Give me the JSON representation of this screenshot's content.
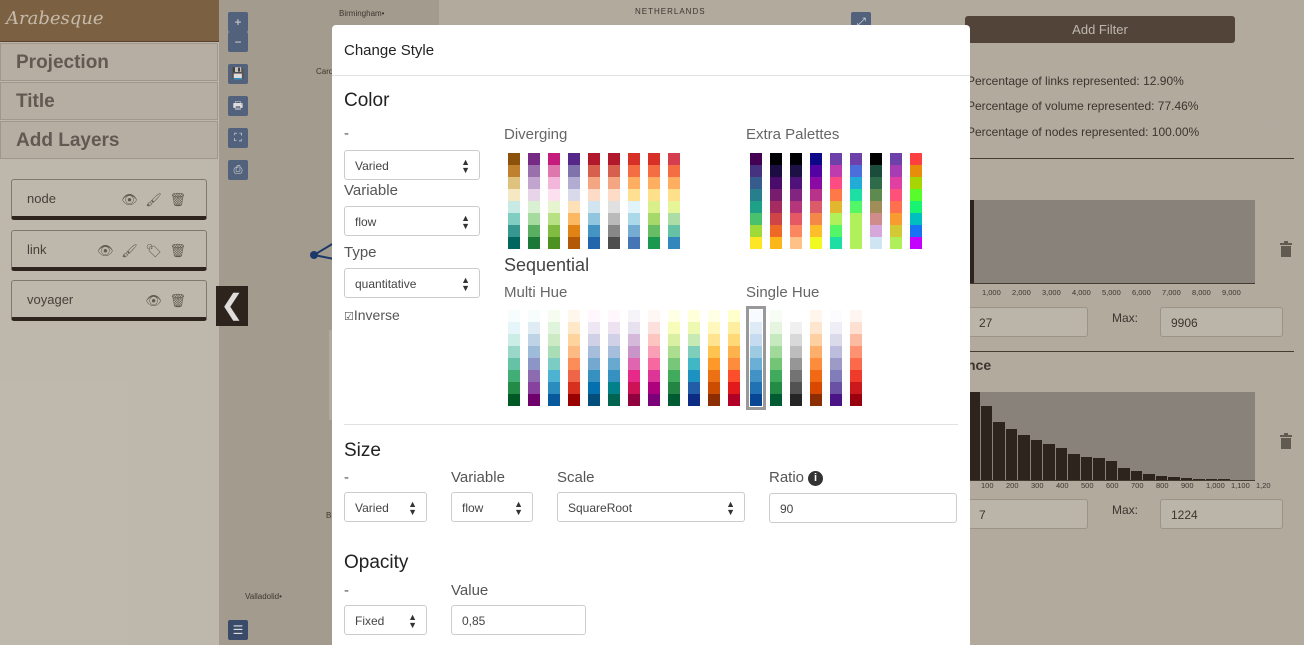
{
  "app": {
    "logo": "Arabesque"
  },
  "sidebar": {
    "menu": [
      "Projection",
      "Title",
      "Add Layers"
    ],
    "layers": [
      {
        "name": "node",
        "icons": "👁 🖌 🗑"
      },
      {
        "name": "link",
        "icons": "👁 🖌 🏷 🗑"
      },
      {
        "name": "voyager",
        "icons": "👁 🗑"
      }
    ],
    "collapse_glyph": "❮"
  },
  "map": {
    "labels": [
      "Birmingham•",
      "NETHERLANDS",
      "Valladolid•",
      "Card",
      "B"
    ],
    "buttons": [
      "+",
      "−",
      "💾",
      "🖶",
      "⛶",
      "⎙"
    ]
  },
  "right_panel": {
    "add_filter": "Add Filter",
    "stats": [
      "Percentage of links represented: 12.90%",
      "Percentage of volume represented: 77.46%",
      "Percentage of nodes represented: 100.00%"
    ],
    "hist1": {
      "axis": [
        "1,000",
        "2,000",
        "3,000",
        "4,000",
        "5,000",
        "6,000",
        "7,000",
        "8,000",
        "9,000"
      ],
      "min": "27",
      "max_label": "Max:",
      "max": "9906"
    },
    "hist2": {
      "title": "nce",
      "axis": [
        "100",
        "200",
        "300",
        "400",
        "500",
        "600",
        "700",
        "800",
        "900",
        "1,000",
        "1,100",
        "1,20"
      ],
      "min": "7",
      "max_label": "Max:",
      "max": "1224",
      "bar_levels": [
        1.0,
        0.84,
        0.66,
        0.58,
        0.51,
        0.46,
        0.41,
        0.36,
        0.3,
        0.26,
        0.25,
        0.22,
        0.14,
        0.1,
        0.07,
        0.04,
        0.03,
        0.02,
        0.01,
        0.01,
        0.01
      ]
    }
  },
  "modal": {
    "title": "Change Style",
    "color": {
      "heading": "Color",
      "dash": "-",
      "mode": "Varied",
      "variable_label": "Variable",
      "variable": "flow",
      "type_label": "Type",
      "type": "quantitative",
      "inverse_label": "Inverse",
      "inverse_checkbox": "☑",
      "diverging_label": "Diverging",
      "extra_label": "Extra Palettes",
      "sequential_label": "Sequential",
      "multi_label": "Multi Hue",
      "single_label": "Single Hue"
    },
    "size": {
      "heading": "Size",
      "dash": "-",
      "mode": "Varied",
      "variable_label": "Variable",
      "variable": "flow",
      "scale_label": "Scale",
      "scale": "SquareRoot",
      "ratio_label": "Ratio",
      "ratio_info": "i",
      "ratio": "90"
    },
    "opacity": {
      "heading": "Opacity",
      "dash": "-",
      "mode": "Fixed",
      "value_label": "Value",
      "value": "0,85"
    }
  },
  "palettes": {
    "diverging": [
      [
        "#8c510a",
        "#bf812d",
        "#dfc27d",
        "#f6e8c3",
        "#c7eae5",
        "#80cdc1",
        "#35978f",
        "#01665e"
      ],
      [
        "#762a83",
        "#9970ab",
        "#c2a5cf",
        "#e7d4e8",
        "#d9f0d3",
        "#a6dba0",
        "#5aae61",
        "#1b7837"
      ],
      [
        "#c51b7d",
        "#de77ae",
        "#f1b6da",
        "#fde0ef",
        "#e6f5d0",
        "#b8e186",
        "#7fbc41",
        "#4d9221"
      ],
      [
        "#542788",
        "#8073ac",
        "#b2abd2",
        "#d8daeb",
        "#fee0b6",
        "#fdb863",
        "#e08214",
        "#b35806"
      ],
      [
        "#b2182b",
        "#d6604d",
        "#f4a582",
        "#fddbc7",
        "#d1e5f0",
        "#92c5de",
        "#4393c3",
        "#2166ac"
      ],
      [
        "#b2182b",
        "#d6604d",
        "#f4a582",
        "#fddbc7",
        "#e0e0e0",
        "#bababa",
        "#878787",
        "#4d4d4d"
      ],
      [
        "#d73027",
        "#f46d43",
        "#fdae61",
        "#fee090",
        "#e0f3f8",
        "#abd9e9",
        "#74add1",
        "#4575b4"
      ],
      [
        "#d73027",
        "#f46d43",
        "#fdae61",
        "#fee08b",
        "#d9ef8b",
        "#a6d96a",
        "#66bd63",
        "#1a9850"
      ],
      [
        "#d53e4f",
        "#f46d43",
        "#fdae61",
        "#fee08b",
        "#e6f598",
        "#abdda4",
        "#66c2a5",
        "#3288bd"
      ]
    ],
    "extra": [
      [
        "#440154",
        "#46327e",
        "#365c8d",
        "#277f8e",
        "#1fa187",
        "#4ac16d",
        "#a0da39",
        "#fde725"
      ],
      [
        "#000004",
        "#1b0c41",
        "#4a0c6b",
        "#781c6d",
        "#a52c60",
        "#cf4446",
        "#ed6925",
        "#fbb61a"
      ],
      [
        "#000004",
        "#1c1044",
        "#4f127b",
        "#812581",
        "#b5367a",
        "#e55964",
        "#fb8761",
        "#fec287"
      ],
      [
        "#0d0887",
        "#5302a3",
        "#8b0aa5",
        "#b83289",
        "#db5c68",
        "#f48849",
        "#febd2a",
        "#f0f921"
      ],
      [
        "#6e40aa",
        "#bf3caf",
        "#fe4b83",
        "#ff7847",
        "#e2b72f",
        "#aff05b",
        "#52f667",
        "#1ddfa3"
      ],
      [
        "#6e40aa",
        "#4c6edb",
        "#23abd8",
        "#1ddfa3",
        "#52f667",
        "#aff05b",
        "#aff05b",
        "#aff05b"
      ],
      [
        "#000000",
        "#1b4b3a",
        "#2e6b4a",
        "#5e8a4f",
        "#a08d58",
        "#d08c8b",
        "#d5a7db",
        "#d0e5f4"
      ],
      [
        "#6e40aa",
        "#a83cb3",
        "#df40a1",
        "#ff507a",
        "#ff704e",
        "#f89b31",
        "#d2c934",
        "#afef5a"
      ],
      [
        "#ff4040",
        "#e78d0b",
        "#a7d503",
        "#58fc2a",
        "#18f472",
        "#00bfbf",
        "#1872f4",
        "#c400ff"
      ]
    ],
    "multi_hue": [
      [
        "#f7fcfd",
        "#e5f5f9",
        "#ccece6",
        "#99d8c9",
        "#66c2a4",
        "#41ae76",
        "#238b45",
        "#005824"
      ],
      [
        "#f7fcfd",
        "#e0ecf4",
        "#bfd3e6",
        "#9ebcda",
        "#8c96c6",
        "#8c6bb1",
        "#88419d",
        "#6e016b"
      ],
      [
        "#f7fcf0",
        "#e0f3db",
        "#ccebc5",
        "#a8ddb5",
        "#7bccc4",
        "#4eb3d3",
        "#2b8cbe",
        "#08589e"
      ],
      [
        "#fff7ec",
        "#fee8c8",
        "#fdd49e",
        "#fdbb84",
        "#fc8d59",
        "#ef6548",
        "#d7301f",
        "#990000"
      ],
      [
        "#fff7fb",
        "#ece7f2",
        "#d0d1e6",
        "#a6bddb",
        "#74a9cf",
        "#3690c0",
        "#0570b0",
        "#034e7b"
      ],
      [
        "#fff7fb",
        "#ece2f0",
        "#d0d1e6",
        "#a6bddb",
        "#67a9cf",
        "#3690c0",
        "#02818a",
        "#016450"
      ],
      [
        "#f7f4f9",
        "#e7e1ef",
        "#d4b9da",
        "#c994c7",
        "#df65b0",
        "#e7298a",
        "#ce1256",
        "#91003f"
      ],
      [
        "#fff7f3",
        "#fde0dd",
        "#fcc5c0",
        "#fa9fb5",
        "#f768a1",
        "#dd3497",
        "#ae017e",
        "#7a0177"
      ],
      [
        "#ffffe5",
        "#f7fcb9",
        "#d9f0a3",
        "#addd8e",
        "#78c679",
        "#41ab5d",
        "#238443",
        "#005a32"
      ],
      [
        "#ffffd9",
        "#edf8b1",
        "#c7e9b4",
        "#7fcdbb",
        "#41b6c4",
        "#1d91c0",
        "#225ea8",
        "#0c2c84"
      ],
      [
        "#ffffe5",
        "#fff7bc",
        "#fee391",
        "#fec44f",
        "#fe9929",
        "#ec7014",
        "#cc4c02",
        "#8c2d04"
      ],
      [
        "#ffffcc",
        "#ffeda0",
        "#fed976",
        "#feb24c",
        "#fd8d3c",
        "#fc4e2a",
        "#e31a1c",
        "#b10026"
      ]
    ],
    "single_hue": [
      [
        "#f7fbff",
        "#deebf7",
        "#c6dbef",
        "#9ecae1",
        "#6baed6",
        "#4292c6",
        "#2171b5",
        "#084594"
      ],
      [
        "#f7fcf5",
        "#e5f5e0",
        "#c7e9c0",
        "#a1d99b",
        "#74c476",
        "#41ab5d",
        "#238b45",
        "#005a32"
      ],
      [
        "#ffffff",
        "#f0f0f0",
        "#d9d9d9",
        "#bdbdbd",
        "#969696",
        "#737373",
        "#525252",
        "#252525"
      ],
      [
        "#fff5eb",
        "#fee6ce",
        "#fdd0a2",
        "#fdae6b",
        "#fd8d3c",
        "#f16913",
        "#d94801",
        "#8c2d04"
      ],
      [
        "#fcfbfd",
        "#efedf5",
        "#dadaeb",
        "#bcbddc",
        "#9e9ac8",
        "#807dba",
        "#6a51a3",
        "#4a1486"
      ],
      [
        "#fff5f0",
        "#fee0d2",
        "#fcbba1",
        "#fc9272",
        "#fb6a4a",
        "#ef3b2c",
        "#cb181d",
        "#99000d"
      ]
    ]
  }
}
